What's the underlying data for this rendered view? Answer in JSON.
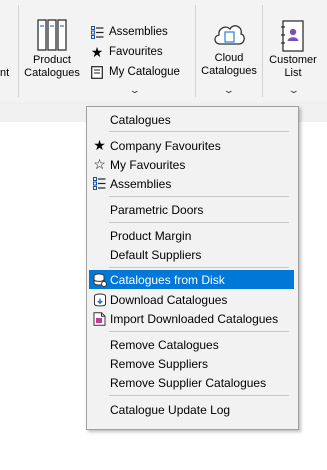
{
  "ribbon": {
    "left_partial_label": "nt",
    "product_catalogues": {
      "line1": "Product",
      "line2": "Catalogues"
    },
    "assemblies": "Assemblies",
    "favourites": "Favourites",
    "my_catalogue": "My Catalogue",
    "cloud_catalogues": {
      "line1": "Cloud",
      "line2": "Catalogues"
    },
    "customer_list": {
      "line1": "Customer",
      "line2": "List"
    }
  },
  "menu": {
    "items": [
      {
        "label": "Catalogues"
      },
      {
        "label": "Company Favourites",
        "icon": "star-filled-icon"
      },
      {
        "label": "My Favourites",
        "icon": "star-outline-icon"
      },
      {
        "label": "Assemblies",
        "icon": "assemblies-icon"
      },
      {
        "label": "Parametric Doors"
      },
      {
        "label": "Product Margin"
      },
      {
        "label": "Default Suppliers"
      },
      {
        "label": "Catalogues from Disk",
        "icon": "disk-database-icon",
        "selected": true
      },
      {
        "label": "Download Catalogues",
        "icon": "download-database-icon"
      },
      {
        "label": "Import Downloaded Catalogues",
        "icon": "import-document-icon"
      },
      {
        "label": "Remove Catalogues"
      },
      {
        "label": "Remove Suppliers"
      },
      {
        "label": "Remove Supplier Catalogues"
      },
      {
        "label": "Catalogue Update Log"
      }
    ]
  },
  "colors": {
    "selection": "#0078d7",
    "menu_bg": "#f2f2f2",
    "ribbon_bg": "#f3f3f3"
  }
}
